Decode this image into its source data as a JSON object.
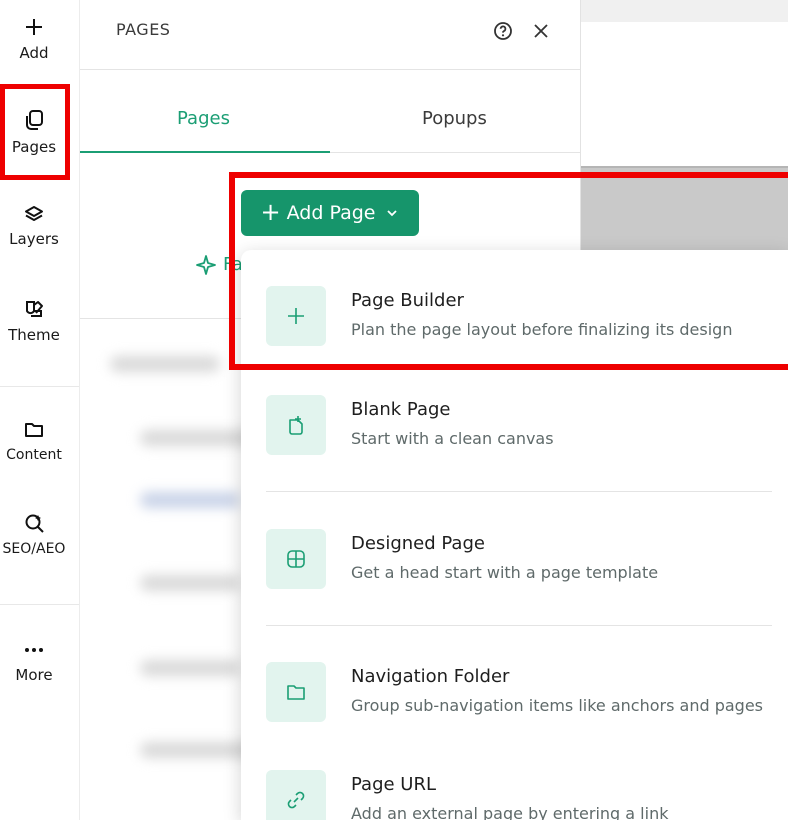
{
  "rail": {
    "items": [
      {
        "label": "Add",
        "icon": "plus-icon"
      },
      {
        "label": "Pages",
        "icon": "pages-icon"
      },
      {
        "label": "Layers",
        "icon": "layers-icon"
      },
      {
        "label": "Theme",
        "icon": "theme-icon"
      },
      {
        "label": "Content",
        "icon": "folder-icon"
      },
      {
        "label": "SEO/AEO",
        "icon": "seo-search-icon"
      },
      {
        "label": "More",
        "icon": "more-icon"
      }
    ]
  },
  "panel": {
    "title": "PAGES",
    "tabs": [
      {
        "label": "Pages",
        "active": true
      },
      {
        "label": "Popups",
        "active": false
      }
    ],
    "ai_text_partial": "Fa"
  },
  "add_button": {
    "label": "Add Page"
  },
  "dropdown": {
    "options": [
      {
        "title": "Page Builder",
        "desc": "Plan the page layout before finalizing its design",
        "icon": "plus-icon"
      },
      {
        "title": "Blank Page",
        "desc": "Start with a clean canvas",
        "icon": "blank-page-icon"
      },
      {
        "title": "Designed Page",
        "desc": "Get a head start with a page template",
        "icon": "grid-icon"
      },
      {
        "title": "Navigation Folder",
        "desc": "Group sub-navigation items like anchors and pages",
        "icon": "folder-icon"
      },
      {
        "title": "Page URL",
        "desc": "Add an external page by entering a link",
        "icon": "link-icon"
      }
    ]
  },
  "colors": {
    "accent": "#16956b",
    "accent_light": "#e2f4ee",
    "highlight": "#ee0000"
  }
}
